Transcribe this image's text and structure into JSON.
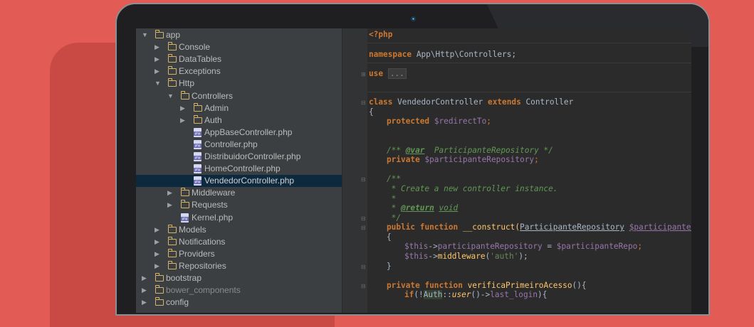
{
  "tree": [
    {
      "label": "app",
      "kind": "folder",
      "indent": 0,
      "expanded": true
    },
    {
      "label": "Console",
      "kind": "folder",
      "indent": 1,
      "expanded": false
    },
    {
      "label": "DataTables",
      "kind": "folder",
      "indent": 1,
      "expanded": false
    },
    {
      "label": "Exceptions",
      "kind": "folder",
      "indent": 1,
      "expanded": false
    },
    {
      "label": "Http",
      "kind": "folder",
      "indent": 1,
      "expanded": true
    },
    {
      "label": "Controllers",
      "kind": "folder",
      "indent": 2,
      "expanded": true
    },
    {
      "label": "Admin",
      "kind": "folder",
      "indent": 3,
      "expanded": false
    },
    {
      "label": "Auth",
      "kind": "folder",
      "indent": 3,
      "expanded": false
    },
    {
      "label": "AppBaseController.php",
      "kind": "file",
      "indent": 3
    },
    {
      "label": "Controller.php",
      "kind": "file",
      "indent": 3
    },
    {
      "label": "DistribuidorController.php",
      "kind": "file",
      "indent": 3
    },
    {
      "label": "HomeController.php",
      "kind": "file",
      "indent": 3
    },
    {
      "label": "VendedorController.php",
      "kind": "file",
      "indent": 3,
      "selected": true
    },
    {
      "label": "Middleware",
      "kind": "folder",
      "indent": 2,
      "expanded": false
    },
    {
      "label": "Requests",
      "kind": "folder",
      "indent": 2,
      "expanded": false
    },
    {
      "label": "Kernel.php",
      "kind": "file",
      "indent": 2
    },
    {
      "label": "Models",
      "kind": "folder",
      "indent": 1,
      "expanded": false
    },
    {
      "label": "Notifications",
      "kind": "folder",
      "indent": 1,
      "expanded": false
    },
    {
      "label": "Providers",
      "kind": "folder",
      "indent": 1,
      "expanded": false
    },
    {
      "label": "Repositories",
      "kind": "folder",
      "indent": 1,
      "expanded": false
    },
    {
      "label": "bootstrap",
      "kind": "folder",
      "indent": 0,
      "expanded": false
    },
    {
      "label": "bower_components",
      "kind": "folder",
      "indent": 0,
      "expanded": false,
      "dim": true
    },
    {
      "label": "config",
      "kind": "folder",
      "indent": 0,
      "expanded": false
    }
  ],
  "code": {
    "php_open": "<?php",
    "namespace_kw": "namespace",
    "namespace_path": "App\\Http\\Controllers;",
    "use_kw": "use",
    "use_fold": "...",
    "class_kw": "class",
    "class_name": "VendedorController",
    "extends_kw": "extends",
    "parent_class": "Controller",
    "brace_open": "{",
    "protected_kw": "protected",
    "redirect_var": "$redirectTo",
    "semicolon": ";",
    "doc_var_open": "/**",
    "doc_var_tag": "@var",
    "doc_var_type": "ParticipanteRepository */",
    "private_kw": "private",
    "participante_var": "$participanteRepository",
    "doc_open": "/**",
    "doc_line1": " * Create a new controller instance.",
    "doc_star": " *",
    "doc_return_star": " * ",
    "doc_return_tag": "@return",
    "doc_return_type": "void",
    "doc_close": " */",
    "public_kw": "public",
    "function_kw": "function",
    "construct_name": "__construct(",
    "param_type": "ParticipanteRepository",
    "param_var": "$participanteRepo",
    "this_var": "$this",
    "arrow": "->",
    "prop_name": "participanteRepository",
    "assign": " = ",
    "assign_var": "$participanteRepo",
    "middleware_call": "middleware",
    "middleware_arg": "'auth'",
    "close_paren_semi": ");",
    "brace_close": "}",
    "verifica_name": "verificaPrimeiroAcesso",
    "verifica_parens": "(){",
    "if_kw": "if",
    "auth_class": "Auth",
    "user_method": "user",
    "last_login": "last_login",
    "if_end": "){"
  }
}
